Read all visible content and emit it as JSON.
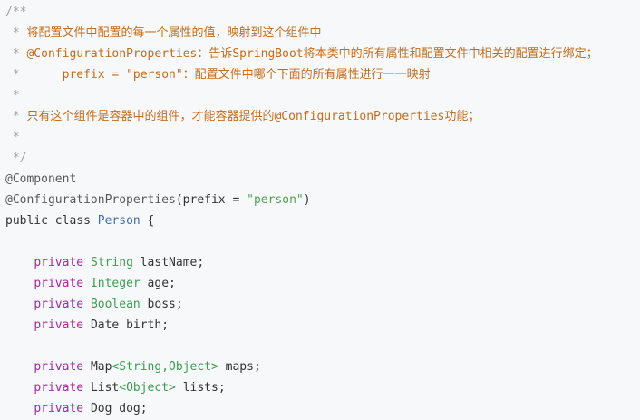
{
  "code": {
    "l1": {
      "star": "/**"
    },
    "l2": {
      "star": " * ",
      "text": "将配置文件中配置的每一个属性的值，映射到这个组件中"
    },
    "l3": {
      "star": " * ",
      "text": "@ConfigurationProperties：告诉SpringBoot将本类中的所有属性和配置文件中相关的配置进行绑定；"
    },
    "l4": {
      "star": " *      ",
      "text": "prefix = \"person\"：配置文件中哪个下面的所有属性进行一一映射"
    },
    "l5": {
      "star": " *"
    },
    "l6": {
      "star": " * ",
      "text": "只有这个组件是容器中的组件，才能容器提供的@ConfigurationProperties功能；"
    },
    "l7": {
      "star": " *"
    },
    "l8": {
      "star": " */"
    },
    "l9": {
      "annotation": "@Component"
    },
    "l10": {
      "annotation": "@ConfigurationProperties",
      "open": "(prefix = ",
      "string": "\"person\"",
      "close": ")"
    },
    "l11": {
      "kw1": "public",
      "kw2": "class",
      "name": "Person",
      "brace": " {"
    },
    "l13": {
      "kw": "private",
      "type": "String",
      "field": " lastName;"
    },
    "l14": {
      "kw": "private",
      "type": "Integer",
      "field": " age;"
    },
    "l15": {
      "kw": "private",
      "type": "Boolean",
      "field": " boss;"
    },
    "l16": {
      "kw": "private",
      "type": "Date",
      "field": " birth;"
    },
    "l18": {
      "kw": "private",
      "t1": "Map",
      "g1": "<String,Object>",
      "field": " maps;"
    },
    "l19": {
      "kw": "private",
      "t1": "List",
      "g1": "<Object>",
      "field": " lists;"
    },
    "l20": {
      "kw": "private",
      "t1": "Dog",
      "field": " dog;"
    }
  },
  "colors": {
    "background": "#f6f8fa",
    "comment": "#a0a0a0",
    "comment_text": "#c66b17",
    "keyword": "#a626a4",
    "type": "#3a9f4f"
  }
}
